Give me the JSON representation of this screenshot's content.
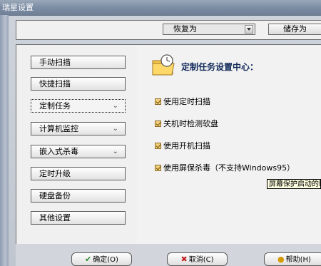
{
  "window": {
    "title": "瑞星设置"
  },
  "toolbar": {
    "restore_label": "恢复为",
    "save_as_label": "储存为"
  },
  "sidebar": {
    "items": [
      {
        "label": "手动扫描",
        "has_chevron": false,
        "selected": false
      },
      {
        "label": "快捷扫描",
        "has_chevron": false,
        "selected": false
      },
      {
        "label": "定制任务",
        "has_chevron": true,
        "selected": true
      },
      {
        "label": "计算机监控",
        "has_chevron": true,
        "selected": false
      },
      {
        "label": "嵌入式杀毒",
        "has_chevron": true,
        "selected": false
      },
      {
        "label": "定时升级",
        "has_chevron": false,
        "selected": false
      },
      {
        "label": "硬盘备份",
        "has_chevron": false,
        "selected": false
      },
      {
        "label": "其他设置",
        "has_chevron": false,
        "selected": false
      }
    ]
  },
  "content": {
    "title": "定制任务设置中心：",
    "options": [
      {
        "label": "使用定时扫描",
        "checked": true
      },
      {
        "label": "关机时检测软盘",
        "checked": true
      },
      {
        "label": "使用开机扫描",
        "checked": true
      },
      {
        "label": "使用屏保杀毒（不支持Windows95）",
        "checked": true
      }
    ],
    "tooltip": "屏幕保护启动的时"
  },
  "buttons": {
    "ok": "确定(O)",
    "cancel": "取消(C)",
    "help": "帮助(H)"
  },
  "colors": {
    "title_bar": "#7f8fa6",
    "checkbox": "#f3d07a",
    "tooltip_bg": "#ffffe1"
  }
}
